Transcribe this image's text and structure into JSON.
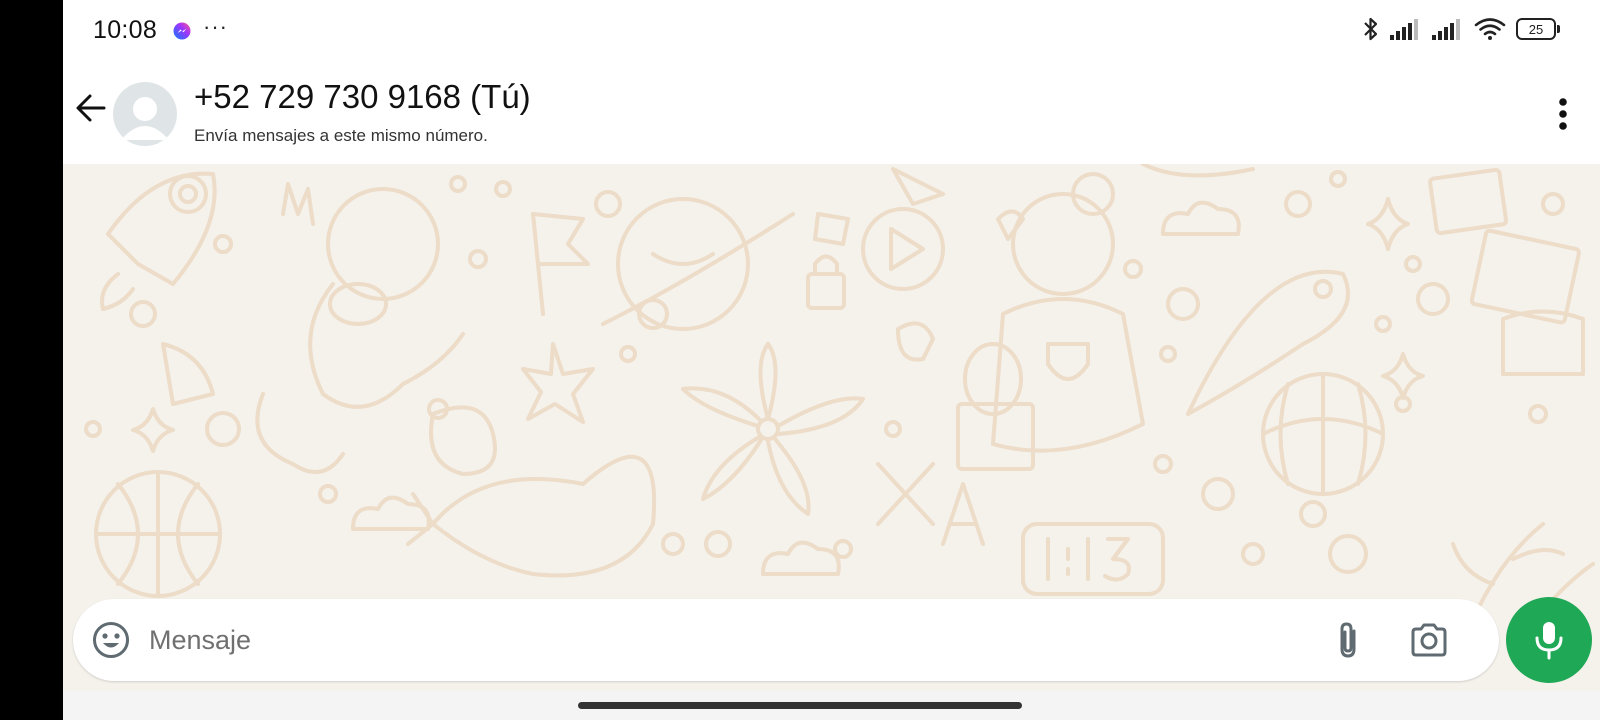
{
  "status_bar": {
    "time": "10:08",
    "more": "···",
    "battery_level": "25",
    "icons": [
      "messenger-icon",
      "bluetooth-icon",
      "signal-icon",
      "signal-icon",
      "wifi-icon",
      "battery-icon"
    ]
  },
  "header": {
    "contact_name": "+52 729 730 9168 (Tú)",
    "subtitle": "Envía mensajes a este mismo número."
  },
  "input": {
    "placeholder": "Mensaje"
  },
  "colors": {
    "mic_button": "#1fa855",
    "chat_background": "#f5f1eb",
    "doodle": "#ecdcc8"
  }
}
